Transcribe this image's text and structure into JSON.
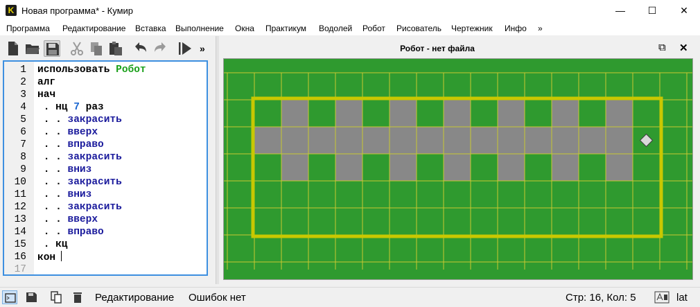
{
  "window": {
    "title": "Новая программа* - Кумир",
    "app_icon_letter": "K",
    "controls": {
      "minimize": "—",
      "maximize": "☐",
      "close": "✕"
    }
  },
  "menu": {
    "items": [
      "Программа",
      "Редактирование",
      "Вставка",
      "Выполнение",
      "Окна",
      "Практикум",
      "Водолей",
      "Робот",
      "Рисователь",
      "Чертежник",
      "Инфо"
    ],
    "more": "»"
  },
  "toolbar": {
    "icons": [
      "new-file-icon",
      "open-folder-icon",
      "save-icon",
      "cut-icon",
      "copy-icon",
      "paste-icon",
      "undo-icon",
      "redo-icon",
      "run-icon"
    ],
    "more": "»"
  },
  "editor": {
    "lines": [
      {
        "n": "1",
        "indent": "",
        "parts": [
          {
            "t": "использовать ",
            "c": "kw"
          },
          {
            "t": "Робот",
            "c": "kw-green"
          }
        ]
      },
      {
        "n": "2",
        "indent": "",
        "parts": [
          {
            "t": "алг",
            "c": "kw"
          }
        ]
      },
      {
        "n": "3",
        "indent": "",
        "parts": [
          {
            "t": "нач",
            "c": "kw"
          }
        ]
      },
      {
        "n": "4",
        "indent": " . ",
        "parts": [
          {
            "t": "нц ",
            "c": "kw"
          },
          {
            "t": "7",
            "c": "num"
          },
          {
            "t": " раз",
            "c": "kw"
          }
        ]
      },
      {
        "n": "5",
        "indent": " . . ",
        "parts": [
          {
            "t": "закрасить",
            "c": "cmd"
          }
        ]
      },
      {
        "n": "6",
        "indent": " . . ",
        "parts": [
          {
            "t": "вверх",
            "c": "cmd"
          }
        ]
      },
      {
        "n": "7",
        "indent": " . . ",
        "parts": [
          {
            "t": "вправо",
            "c": "cmd"
          }
        ]
      },
      {
        "n": "8",
        "indent": " . . ",
        "parts": [
          {
            "t": "закрасить",
            "c": "cmd"
          }
        ]
      },
      {
        "n": "9",
        "indent": " . . ",
        "parts": [
          {
            "t": "вниз",
            "c": "cmd"
          }
        ]
      },
      {
        "n": "10",
        "indent": " . . ",
        "parts": [
          {
            "t": "закрасить",
            "c": "cmd"
          }
        ]
      },
      {
        "n": "11",
        "indent": " . . ",
        "parts": [
          {
            "t": "вниз",
            "c": "cmd"
          }
        ]
      },
      {
        "n": "12",
        "indent": " . . ",
        "parts": [
          {
            "t": "закрасить",
            "c": "cmd"
          }
        ]
      },
      {
        "n": "13",
        "indent": " . . ",
        "parts": [
          {
            "t": "вверх",
            "c": "cmd"
          }
        ]
      },
      {
        "n": "14",
        "indent": " . . ",
        "parts": [
          {
            "t": "вправо",
            "c": "cmd"
          }
        ]
      },
      {
        "n": "15",
        "indent": " . ",
        "parts": [
          {
            "t": "кц",
            "c": "kw"
          }
        ]
      },
      {
        "n": "16",
        "indent": "",
        "parts": [
          {
            "t": "кон",
            "c": "kw"
          }
        ],
        "cursor": true
      },
      {
        "n": "17",
        "indent": "",
        "parts": [],
        "dim": true
      }
    ]
  },
  "robot": {
    "title": "Робот - нет файла",
    "controls": {
      "undock": "⧉",
      "close": "✕"
    },
    "colors": {
      "field": "#2f9a2f",
      "grid": "#c8c832",
      "wall": "#c8c800",
      "painted": "#888888",
      "robot": "#d9d9d9"
    },
    "field_cols": 15,
    "field_rows": 5,
    "painted_cells": [
      [
        1,
        0
      ],
      [
        3,
        0
      ],
      [
        5,
        0
      ],
      [
        7,
        0
      ],
      [
        9,
        0
      ],
      [
        11,
        0
      ],
      [
        13,
        0
      ],
      [
        0,
        1
      ],
      [
        1,
        1
      ],
      [
        2,
        1
      ],
      [
        3,
        1
      ],
      [
        4,
        1
      ],
      [
        5,
        1
      ],
      [
        6,
        1
      ],
      [
        7,
        1
      ],
      [
        8,
        1
      ],
      [
        9,
        1
      ],
      [
        10,
        1
      ],
      [
        11,
        1
      ],
      [
        12,
        1
      ],
      [
        13,
        1
      ],
      [
        1,
        2
      ],
      [
        3,
        2
      ],
      [
        5,
        2
      ],
      [
        7,
        2
      ],
      [
        9,
        2
      ],
      [
        11,
        2
      ],
      [
        13,
        2
      ]
    ],
    "robot_cell": [
      14,
      1
    ]
  },
  "status": {
    "mode": "Редактирование",
    "errors": "Ошибок нет",
    "position": "Стр: 16, Кол: 5",
    "layout": "lat"
  }
}
